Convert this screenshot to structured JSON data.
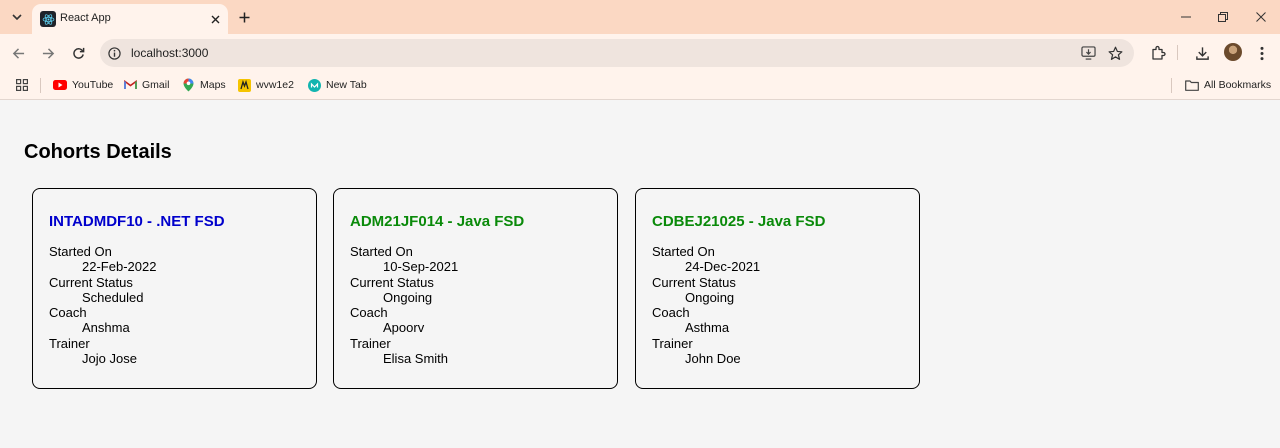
{
  "browser": {
    "tab_title": "React App",
    "url": "localhost:3000",
    "bookmarks": [
      {
        "label": "YouTube",
        "icon": "youtube-icon"
      },
      {
        "label": "Gmail",
        "icon": "gmail-icon"
      },
      {
        "label": "Maps",
        "icon": "maps-icon"
      },
      {
        "label": "wvw1e2",
        "icon": "bookmark-favicon"
      },
      {
        "label": "New Tab",
        "icon": "new-tab-favicon"
      }
    ],
    "all_bookmarks": "All Bookmarks",
    "theme": {
      "tabstrip": "#fbd8c3",
      "toolbar": "#fff3ec",
      "omnibox": "#efe4de"
    }
  },
  "page": {
    "title": "Cohorts Details",
    "cohorts": [
      {
        "title": "INTADMDF10 - .NET FSD",
        "title_color": "#0000cc",
        "started_label": "Started On",
        "started": "22-Feb-2022",
        "status_label": "Current Status",
        "status": "Scheduled",
        "coach_label": "Coach",
        "coach": "Anshma",
        "trainer_label": "Trainer",
        "trainer": "Jojo Jose"
      },
      {
        "title": "ADM21JF014 - Java FSD",
        "title_color": "#0a8a0a",
        "started_label": "Started On",
        "started": "10-Sep-2021",
        "status_label": "Current Status",
        "status": "Ongoing",
        "coach_label": "Coach",
        "coach": "Apoorv",
        "trainer_label": "Trainer",
        "trainer": "Elisa Smith"
      },
      {
        "title": "CDBEJ21025 - Java FSD",
        "title_color": "#0a8a0a",
        "started_label": "Started On",
        "started": "24-Dec-2021",
        "status_label": "Current Status",
        "status": "Ongoing",
        "coach_label": "Coach",
        "coach": "Asthma",
        "trainer_label": "Trainer",
        "trainer": "John Doe"
      }
    ]
  }
}
